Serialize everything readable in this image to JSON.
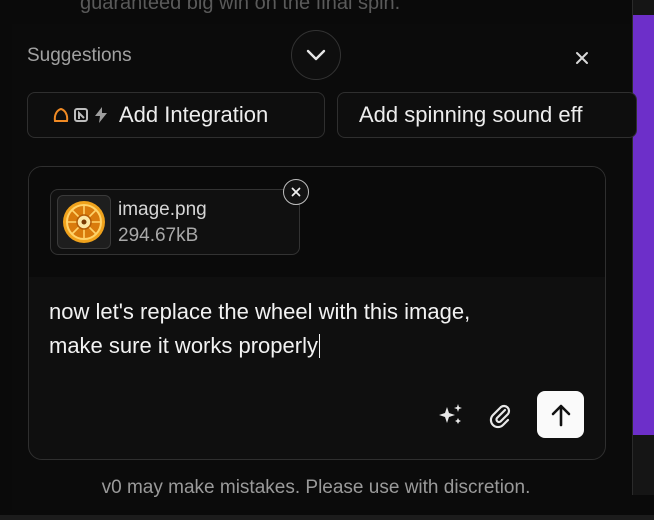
{
  "background": {
    "message_fragment": "guaranteed big win on the final spin."
  },
  "suggestions": {
    "title": "Suggestions",
    "collapse_icon": "chevron-down-icon",
    "close_icon": "close-icon",
    "chips": [
      {
        "label": "Add Integration",
        "icons": [
          "supabase-icon",
          "neon-icon",
          "lightning-icon"
        ]
      },
      {
        "label": "Add spinning sound eff"
      }
    ]
  },
  "composer": {
    "attachment": {
      "name": "image.png",
      "size": "294.67kB",
      "thumbnail_icon": "wheel-image-thumbnail",
      "remove_icon": "close-icon"
    },
    "text_line_1": "now let's replace the wheel with this image,",
    "text_line_2": "make sure it works properly",
    "actions": {
      "enhance_icon": "sparkles-icon",
      "attach_icon": "paperclip-icon",
      "send_icon": "arrow-up-icon"
    }
  },
  "disclaimer": "v0 may make mistakes. Please use with discretion.",
  "colors": {
    "background": "#0a0a0a",
    "accent_purple": "#6d2fc9",
    "send_button": "#fafafa",
    "text_primary": "#ededed",
    "text_muted": "#a1a1a1"
  }
}
